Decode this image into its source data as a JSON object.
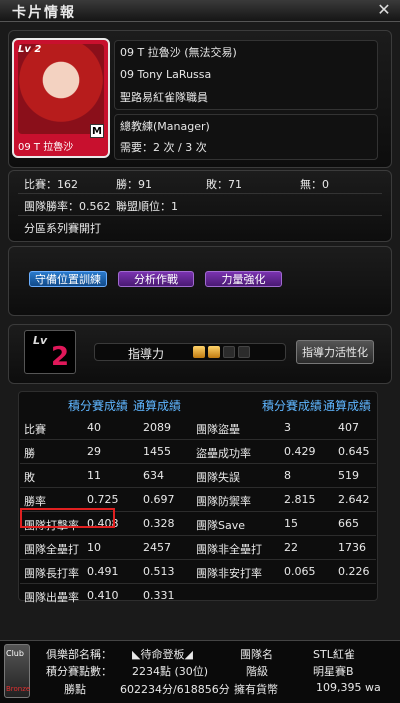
{
  "window": {
    "title": "卡片情報",
    "close_glyph": "✕"
  },
  "card": {
    "lv_badge": "Lv 2",
    "type_badge": "M",
    "name": "09 T 拉魯沙",
    "line1": "09 T 拉魯沙 (無法交易)",
    "line2": "09 Tony LaRussa",
    "line3": "聖路易紅雀隊職員",
    "role": "總教練(Manager)",
    "need": "需要：2 次 / 3 次"
  },
  "record": {
    "games": "比賽：162",
    "wins": "勝：91",
    "losses": "敗：71",
    "ties": "無：0",
    "win_pct": "團隊勝率：0.562",
    "league_rank": "聯盟順位：1",
    "playoff": "分區系列賽開打"
  },
  "actions": {
    "defense": "守備位置訓練",
    "analysis": "分析作戰",
    "power": "力量強化"
  },
  "guidance": {
    "lv_text": "Lv",
    "lv_num": "2",
    "label": "指導力",
    "level": 2,
    "max": 4,
    "activate": "指導力活性化"
  },
  "stats": {
    "headers_left": [
      "積分賽成績",
      "通算成績"
    ],
    "headers_right": [
      "積分賽成績",
      "通算成績"
    ],
    "left_rows": [
      {
        "label": "比賽",
        "a": "40",
        "b": "2089"
      },
      {
        "label": "勝",
        "a": "29",
        "b": "1455"
      },
      {
        "label": "敗",
        "a": "11",
        "b": "634"
      },
      {
        "label": "勝率",
        "a": "0.725",
        "b": "0.697"
      },
      {
        "label": "團隊打擊率",
        "a": "0.408",
        "b": "0.328"
      },
      {
        "label": "團隊全壘打",
        "a": "10",
        "b": "2457"
      },
      {
        "label": "團隊長打率",
        "a": "0.491",
        "b": "0.513"
      },
      {
        "label": "團隊出壘率",
        "a": "0.410",
        "b": "0.331"
      }
    ],
    "right_rows": [
      {
        "label": "團隊盜壘",
        "a": "3",
        "b": "407"
      },
      {
        "label": "盜壘成功率",
        "a": "0.429",
        "b": "0.645"
      },
      {
        "label": "團隊失誤",
        "a": "8",
        "b": "519"
      },
      {
        "label": "團隊防禦率",
        "a": "2.815",
        "b": "2.642"
      },
      {
        "label": "團隊Save",
        "a": "15",
        "b": "665"
      },
      {
        "label": "團隊非全壘打",
        "a": "22",
        "b": "1736"
      },
      {
        "label": "團隊非安打率",
        "a": "0.065",
        "b": "0.226"
      }
    ]
  },
  "footer": {
    "club_word": "Club",
    "club_rank": "Bronze",
    "club_label": "俱樂部名稱：",
    "club_value": "◣待命登板◢",
    "points_label": "積分賽點數：",
    "points_value": "2234點 (30位)",
    "jersey_label": "勝點",
    "jersey_value": "602234分/618856分",
    "team_label": "團隊名",
    "team_value": "STL紅雀",
    "tier_label": "階級",
    "tier_value": "明星賽B",
    "money_label": "擁有貨幣",
    "money_value": "109,395 wa"
  }
}
